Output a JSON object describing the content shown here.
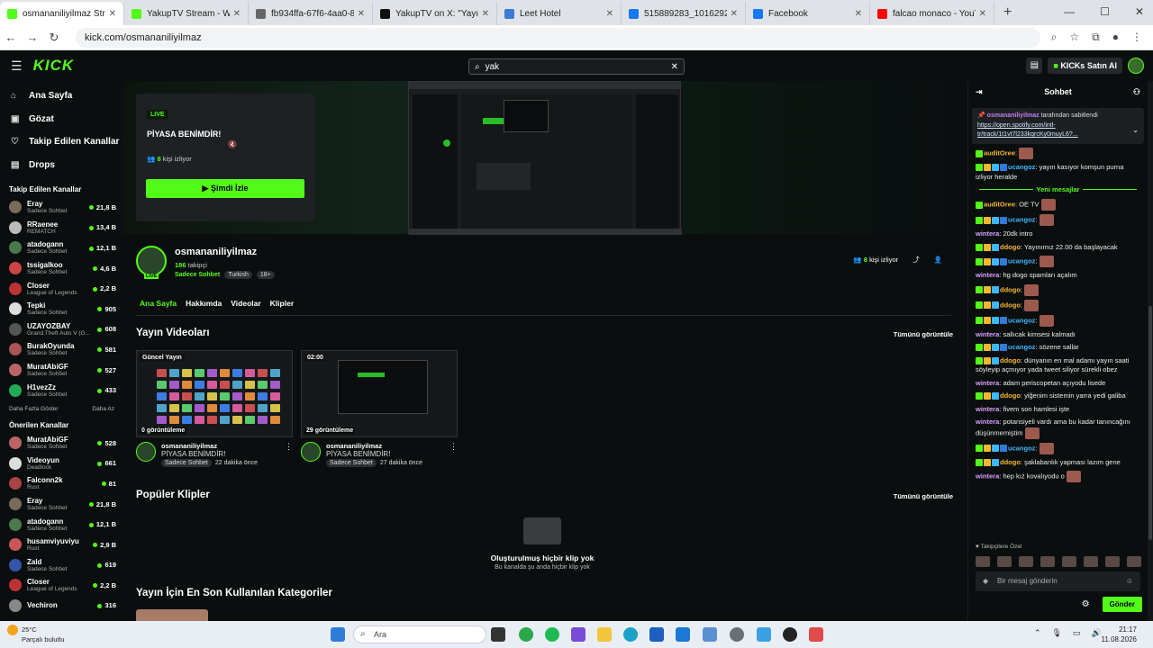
{
  "browser": {
    "tabs": [
      {
        "title": "osmananiliyilmaz Stream",
        "color": "#53fc18",
        "active": true
      },
      {
        "title": "YakupTV Stream - Watch",
        "color": "#53fc18",
        "active": false
      },
      {
        "title": "fb934ffa-67f6-4aa0-8d8f",
        "color": "#666666",
        "active": false
      },
      {
        "title": "YakupTV on X: \"Yayınımız",
        "color": "#111111",
        "active": false
      },
      {
        "title": "Leet Hotel",
        "color": "#3a7bd5",
        "active": false
      },
      {
        "title": "515889283_10162929699",
        "color": "#1877f2",
        "active": false
      },
      {
        "title": "Facebook",
        "color": "#1877f2",
        "active": false
      },
      {
        "title": "falcao monaco - YouTube",
        "color": "#ff0000",
        "active": false
      }
    ],
    "url": "kick.com/osmananiliyilmaz"
  },
  "kick": {
    "logo": "KICK",
    "search_value": "yak",
    "kicks_button": "KICKs Satın Al"
  },
  "sidebar": {
    "nav": [
      {
        "label": "Ana Sayfa",
        "icon": "home-icon",
        "glyph": "⌂"
      },
      {
        "label": "Gözat",
        "icon": "browse-icon",
        "glyph": "▣"
      },
      {
        "label": "Takip Edilen Kanallar",
        "icon": "heart-icon",
        "glyph": "♡"
      },
      {
        "label": "Drops",
        "icon": "drops-icon",
        "glyph": "▤"
      }
    ],
    "followed_title": "Takip Edilen Kanallar",
    "followed": [
      {
        "name": "Eray",
        "cat": "Sadece Sohbet",
        "count": "21,8 B",
        "color": "#7a6a5a"
      },
      {
        "name": "RRaenee",
        "cat": "REMATCH",
        "count": "13,4 B",
        "color": "#bbbbbb"
      },
      {
        "name": "atadogann",
        "cat": "Sadece Sohbet",
        "count": "12,1 B",
        "color": "#4a7a4a"
      },
      {
        "name": "tssigalkoo",
        "cat": "Sadece Sohbet",
        "count": "4,6 B",
        "color": "#c44"
      },
      {
        "name": "Closer",
        "cat": "League of Legends",
        "count": "2,2 B",
        "color": "#b33"
      },
      {
        "name": "Tepki",
        "cat": "Sadece Sohbet",
        "count": "905",
        "color": "#ddd"
      },
      {
        "name": "UZAYOZBAY",
        "cat": "Grand Theft Auto V (G...",
        "count": "608",
        "color": "#555"
      },
      {
        "name": "BurakOyunda",
        "cat": "Sadece Sohbet",
        "count": "581",
        "color": "#a55"
      },
      {
        "name": "MuratAbiGF",
        "cat": "Sadece Sohbet",
        "count": "527",
        "color": "#b66"
      },
      {
        "name": "H1vezZz",
        "cat": "Sadece Sohbet",
        "count": "433",
        "color": "#2a5"
      }
    ],
    "show_more": "Daha Fazla Göster",
    "show_less": "Daha Az",
    "recommended_title": "Önerilen Kanallar",
    "recommended": [
      {
        "name": "MuratAbiGF",
        "cat": "Sadece Sohbet",
        "count": "528",
        "color": "#b66"
      },
      {
        "name": "Videoyun",
        "cat": "Deadlock",
        "count": "661",
        "color": "#ddd"
      },
      {
        "name": "Falconn2k",
        "cat": "Rust",
        "count": "81",
        "color": "#a44"
      },
      {
        "name": "Eray",
        "cat": "Sadece Sohbet",
        "count": "21,8 B",
        "color": "#7a6a5a"
      },
      {
        "name": "atadogann",
        "cat": "Sadece Sohbet",
        "count": "12,1 B",
        "color": "#4a7a4a"
      },
      {
        "name": "husamviyuviyu",
        "cat": "Rust",
        "count": "2,9 B",
        "color": "#c55"
      },
      {
        "name": "Zald",
        "cat": "Sadece Sohbet",
        "count": "619",
        "color": "#35a"
      },
      {
        "name": "Closer",
        "cat": "League of Legends",
        "count": "2,2 B",
        "color": "#b33"
      },
      {
        "name": "Vechiron",
        "cat": "",
        "count": "316",
        "color": "#888"
      }
    ]
  },
  "hero": {
    "live": "LIVE",
    "title": "PİYASA BENİMDİR!",
    "viewers_num": "8",
    "viewers_text": "kişi izliyor",
    "watch": "Şimdi İzle"
  },
  "channel": {
    "name": "osmananiliyilmaz",
    "live": "LIVE",
    "followers_num": "186",
    "followers_text": "takipçi",
    "category": "Sadece Sohbet",
    "tags": [
      "Turkish",
      "18+"
    ],
    "viewers_num": "8",
    "viewers_text": "kişi izliyor",
    "tabs": [
      "Ana Sayfa",
      "Hakkımda",
      "Videolar",
      "Klipler"
    ]
  },
  "videos": {
    "heading": "Yayın Videoları",
    "see_all": "Tümünü görüntüle",
    "items": [
      {
        "label": "Güncel Yayın",
        "views": "0 görüntüleme",
        "channel": "osmananiliyilmaz",
        "title": "PİYASA BENİMDİR!",
        "category": "Sadece Sohbet",
        "time": "22 dakika önce"
      },
      {
        "label": "02:00",
        "views": "29 görüntüleme",
        "channel": "osmananiliyilmaz",
        "title": "PİYASA BENİMDİR!",
        "category": "Sadece Sohbet",
        "time": "27 dakika önce"
      }
    ]
  },
  "clips": {
    "heading": "Popüler Klipler",
    "see_all": "Tümünü görüntüle",
    "empty_title": "Oluşturulmuş hiçbir klip yok",
    "empty_sub": "Bu kanalda şu anda hiçbir klip yok"
  },
  "categories": {
    "heading": "Yayın İçin En Son Kullanılan Kategoriler"
  },
  "chat": {
    "title": "Sohbet",
    "pinned_by_user": "osmananiliyilmaz",
    "pinned_by_text": "tarafından sabitlendi",
    "pinned_link": "https://open.spotify.com/intl-tr/track/1t1vt7l233kqrcKy0muyL6?...",
    "new_messages": "Yeni mesajlar",
    "messages_before": [
      {
        "user": "auditOree",
        "color": "#f5b731",
        "text": "",
        "badges": 1,
        "emote": true
      },
      {
        "user": "ucangoz",
        "color": "#3fb7ff",
        "text": "yayın kasıyor komşun purna izliyor heralde",
        "badges": 4,
        "emote": false
      }
    ],
    "messages_after": [
      {
        "user": "auditOree",
        "color": "#f5b731",
        "text": "OE TV",
        "badges": 1,
        "emote": true
      },
      {
        "user": "ucangoz",
        "color": "#3fb7ff",
        "text": "",
        "badges": 4,
        "emote": true
      },
      {
        "user": "wintera",
        "color": "#d9a0ff",
        "text": "20dk intro",
        "badges": 0,
        "emote": false
      },
      {
        "user": "ddogo",
        "color": "#f5b731",
        "text": "Yayınımız 22.00 da başlayacak",
        "badges": 3,
        "emote": false
      },
      {
        "user": "ucangoz",
        "color": "#3fb7ff",
        "text": "",
        "badges": 4,
        "emote": true
      },
      {
        "user": "wintera",
        "color": "#d9a0ff",
        "text": "hg dogo spamları açalım",
        "badges": 0,
        "emote": false
      },
      {
        "user": "ddogo",
        "color": "#f5b731",
        "text": "",
        "badges": 3,
        "emote": true
      },
      {
        "user": "ddogo",
        "color": "#f5b731",
        "text": "",
        "badges": 3,
        "emote": true
      },
      {
        "user": "ucangoz",
        "color": "#3fb7ff",
        "text": "",
        "badges": 4,
        "emote": true
      },
      {
        "user": "wintera",
        "color": "#d9a0ff",
        "text": "sallıcak kimsesi kalmadı",
        "badges": 0,
        "emote": false
      },
      {
        "user": "ucangoz",
        "color": "#3fb7ff",
        "text": "sözene sallar",
        "badges": 4,
        "emote": false
      },
      {
        "user": "ddogo",
        "color": "#f5b731",
        "text": "dünyanın en mal adamı yayın saati söyleyip açmıyor yada tweet siliyor sürekli obez",
        "badges": 3,
        "emote": false
      },
      {
        "user": "wintera",
        "color": "#d9a0ff",
        "text": "adam periscopetan açıyodu lisede",
        "badges": 0,
        "emote": false
      },
      {
        "user": "ddogo",
        "color": "#f5b731",
        "text": "yiğenim sistemin yarra yedi galiba",
        "badges": 3,
        "emote": false
      },
      {
        "user": "wintera",
        "color": "#d9a0ff",
        "text": "fivem son hamlesi işte",
        "badges": 0,
        "emote": false
      },
      {
        "user": "wintera",
        "color": "#d9a0ff",
        "text": "potansiyeli vardı ama bu kadar tanıncağını düşünmemiştim",
        "badges": 0,
        "emote": true
      },
      {
        "user": "ucangoz",
        "color": "#3fb7ff",
        "text": "",
        "badges": 4,
        "emote": true
      },
      {
        "user": "ddogo",
        "color": "#f5b731",
        "text": "şaklabanlık yapması lazım gene",
        "badges": 3,
        "emote": false
      },
      {
        "user": "wintera",
        "color": "#d9a0ff",
        "text": "hep kız kovalıyodu o",
        "badges": 0,
        "emote": true
      }
    ],
    "subs_label": "Takipçilere Özel",
    "input_placeholder": "Bir mesaj gönderin",
    "send": "Gönder"
  },
  "taskbar": {
    "temp": "25°C",
    "weather": "Parçalı bulutlu",
    "search": "Ara",
    "time": "21:17",
    "date": "11.08.2026"
  }
}
